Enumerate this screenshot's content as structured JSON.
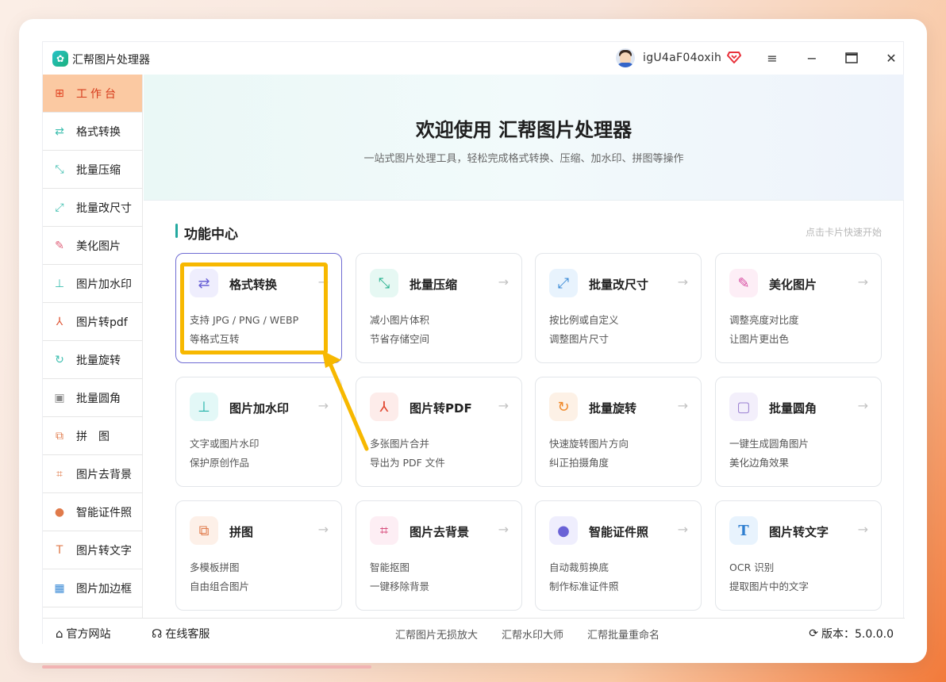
{
  "app": {
    "title": "汇帮图片处理器",
    "username": "igU4aF04oxih"
  },
  "sidebar": {
    "items": [
      {
        "label": "工作台",
        "icon": "grid-icon",
        "color": "#e0401e"
      },
      {
        "label": "格式转换",
        "icon": "format-convert-icon",
        "color": "#3fbfb0"
      },
      {
        "label": "批量压缩",
        "icon": "compress-icon",
        "color": "#3fbfb0"
      },
      {
        "label": "批量改尺寸",
        "icon": "resize-icon",
        "color": "#3fbfb0"
      },
      {
        "label": "美化图片",
        "icon": "beautify-icon",
        "color": "#e0607a"
      },
      {
        "label": "图片加水印",
        "icon": "watermark-icon",
        "color": "#3fbfb0"
      },
      {
        "label": "图片转pdf",
        "icon": "pdf-icon",
        "color": "#e05a3a"
      },
      {
        "label": "批量旋转",
        "icon": "rotate-icon",
        "color": "#3fbfb0"
      },
      {
        "label": "批量圆角",
        "icon": "round-corner-icon",
        "color": "#8a8a8a"
      },
      {
        "label": "拼　图",
        "icon": "puzzle-icon",
        "color": "#e07a4a"
      },
      {
        "label": "图片去背景",
        "icon": "crop-icon",
        "color": "#e07a4a"
      },
      {
        "label": "智能证件照",
        "icon": "person-icon",
        "color": "#e07a4a"
      },
      {
        "label": "图片转文字",
        "icon": "text-icon",
        "color": "#e07a4a"
      },
      {
        "label": "图片加边框",
        "icon": "frame-icon",
        "color": "#3a8ad6"
      }
    ]
  },
  "hero": {
    "title": "欢迎使用 汇帮图片处理器",
    "subtitle": "一站式图片处理工具，轻松完成格式转换、压缩、加水印、拼图等操作"
  },
  "section": {
    "title": "功能中心",
    "hint": "点击卡片快速开始"
  },
  "cards": [
    {
      "title": "格式转换",
      "line1": "支持 JPG / PNG / WEBP",
      "line2": "等格式互转",
      "icon": "format-convert-icon",
      "bg": "#efeefd",
      "fg": "#6a62d6",
      "glyph": "⇄"
    },
    {
      "title": "批量压缩",
      "line1": "减小图片体积",
      "line2": "节省存储空间",
      "icon": "compress-icon",
      "bg": "#e6f8f3",
      "fg": "#22b08c",
      "glyph": "⤡"
    },
    {
      "title": "批量改尺寸",
      "line1": "按比例或自定义",
      "line2": "调整图片尺寸",
      "icon": "resize-icon",
      "bg": "#e8f3fd",
      "fg": "#3a8ad6",
      "glyph": "⤢"
    },
    {
      "title": "美化图片",
      "line1": "调整亮度对比度",
      "line2": "让图片更出色",
      "icon": "beautify-icon",
      "bg": "#fdeef6",
      "fg": "#d64aa0",
      "glyph": "✎"
    },
    {
      "title": "图片加水印",
      "line1": "文字或图片水印",
      "line2": "保护原创作品",
      "icon": "watermark-icon",
      "bg": "#e3f8f7",
      "fg": "#1fb2a8",
      "glyph": "⊥"
    },
    {
      "title": "图片转PDF",
      "line1": "多张图片合并",
      "line2": "导出为 PDF 文件",
      "icon": "pdf-icon",
      "bg": "#fdecea",
      "fg": "#e0442c",
      "glyph": "⅄"
    },
    {
      "title": "批量旋转",
      "line1": "快速旋转图片方向",
      "line2": "纠正拍摄角度",
      "icon": "rotate-icon",
      "bg": "#fdf1e6",
      "fg": "#f0892a",
      "glyph": "↻"
    },
    {
      "title": "批量圆角",
      "line1": "一键生成圆角图片",
      "line2": "美化边角效果",
      "icon": "round-corner-icon",
      "bg": "#f3effb",
      "fg": "#9a7fd1",
      "glyph": "▢"
    },
    {
      "title": "拼图",
      "line1": "多模板拼图",
      "line2": "自由组合图片",
      "icon": "puzzle-icon",
      "bg": "#fdf0e8",
      "fg": "#e07a4a",
      "glyph": "⧉"
    },
    {
      "title": "图片去背景",
      "line1": "智能抠图",
      "line2": "一键移除背景",
      "icon": "crop-icon",
      "bg": "#fdeef4",
      "fg": "#d64a7a",
      "glyph": "⌗"
    },
    {
      "title": "智能证件照",
      "line1": "自动裁剪换底",
      "line2": "制作标准证件照",
      "icon": "person-icon",
      "bg": "#efeefd",
      "fg": "#6a62d6",
      "glyph": "●"
    },
    {
      "title": "图片转文字",
      "line1": "OCR 识别",
      "line2": "提取图片中的文字",
      "icon": "text-icon",
      "bg": "#e8f3fd",
      "fg": "#2f7fd0",
      "glyph": "T"
    }
  ],
  "footer": {
    "official_site": "官方网站",
    "online_service": "在线客服",
    "links": [
      "汇帮图片无损放大",
      "汇帮水印大师",
      "汇帮批量重命名"
    ],
    "version": "版本：5.0.0.0"
  },
  "colors": {
    "accent": "#24a9a0",
    "highlight": "#f7b800",
    "active_bg": "#fbc9a2",
    "active_text": "#d63a1a"
  }
}
